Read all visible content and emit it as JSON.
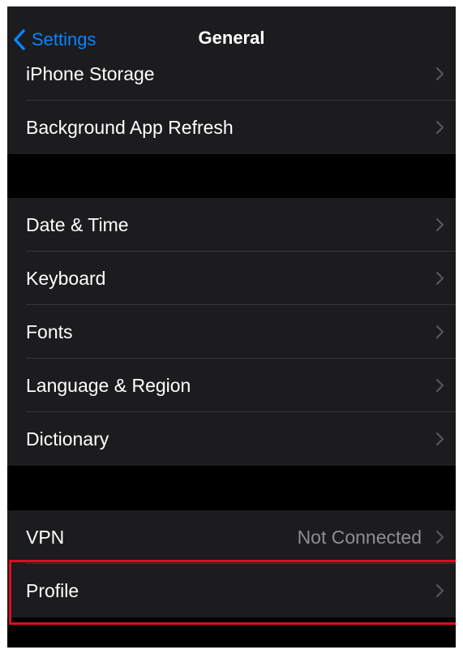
{
  "navbar": {
    "back_label": "Settings",
    "title": "General"
  },
  "groups": [
    {
      "rows": [
        {
          "label": "iPhone Storage"
        },
        {
          "label": "Background App Refresh"
        }
      ]
    },
    {
      "rows": [
        {
          "label": "Date & Time"
        },
        {
          "label": "Keyboard"
        },
        {
          "label": "Fonts"
        },
        {
          "label": "Language & Region"
        },
        {
          "label": "Dictionary"
        }
      ]
    },
    {
      "rows": [
        {
          "label": "VPN",
          "value": "Not Connected"
        },
        {
          "label": "Profile"
        }
      ]
    }
  ],
  "colors": {
    "accent": "#0a84ff",
    "background": "#000000",
    "cell": "#1c1c1e",
    "highlight": "#e00b1f"
  },
  "icons": {
    "back": "chevron-left-icon",
    "disclosure": "chevron-right-icon"
  }
}
